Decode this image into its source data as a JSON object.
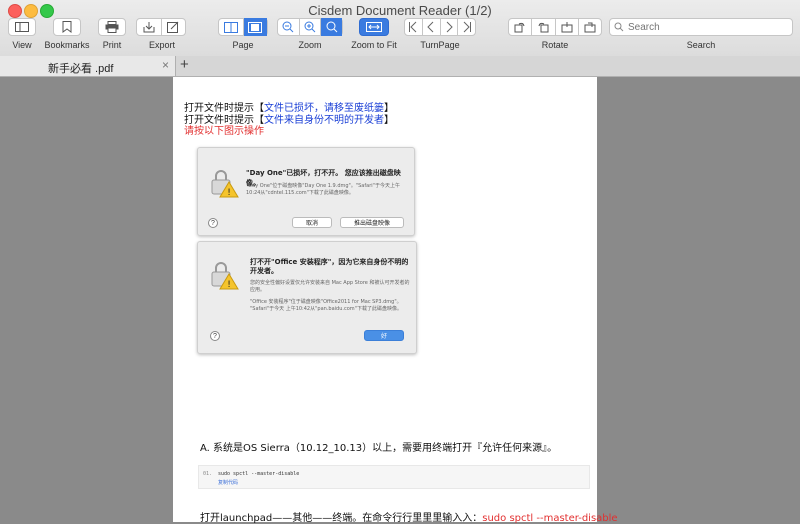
{
  "window": {
    "title": "Cisdem Document Reader (1/2)"
  },
  "toolbar": {
    "view_label": "View",
    "bookmarks_label": "Bookmarks",
    "print_label": "Print",
    "export_label": "Export",
    "page_label": "Page",
    "zoom_label": "Zoom",
    "zoom_to_fit_label": "Zoom to Fit",
    "turnpage_label": "TurnPage",
    "rotate_label": "Rotate",
    "search_label": "Search",
    "search_placeholder": "Search"
  },
  "tabs": [
    {
      "label": "新手必看 .pdf"
    }
  ],
  "document": {
    "line1_prefix": "打开文件时提示【",
    "line1_highlight": "文件已损坏，请移至废纸篓",
    "line1_suffix": "】",
    "line2_prefix": "打开文件时提示【",
    "line2_highlight": "文件来自身份不明的开发者",
    "line2_suffix": "】",
    "line3": "请按以下图示操作",
    "dialog1": {
      "title": "\"Day One\"已损坏，打不开。 您应该推出磁盘映像。",
      "body": "\"Day One\"位于磁盘映像\"Day One 1.9.dmg\"。\"Safari\"于今天上午10:24从\"cdntel.115.com\"下载了此磁盘映像。",
      "cancel": "取消",
      "eject": "推出磁盘映像"
    },
    "dialog2": {
      "title": "打不开\"Office 安装程序\"，因为它来自身份不明的开发者。",
      "body1": "您的安全性偏好设置仅允许安装来自 Mac App Store 和被认可开发者的应用。",
      "body2": "\"Office 安装程序\"位于磁盘映像\"Office2011 for Mac SP3.dmg\"。 \"Safari\"于今天 上午10:42从\"pan.baidu.com\"下载了此磁盘映像。",
      "ok": "好"
    },
    "help_glyph": "?",
    "section_a": "A. 系统是OS Sierra（10.12_10.13）以上，需要用终端打开『允许任何来源』。",
    "code_line_no": "01.",
    "code_text": "sudo spctl --master-disable",
    "code_copy": "复制代码",
    "bottom_prefix": "打开launchpad——其他——终端。在命令行行里里里输入入：",
    "bottom_cmd": "sudo spctl --master-disable"
  }
}
